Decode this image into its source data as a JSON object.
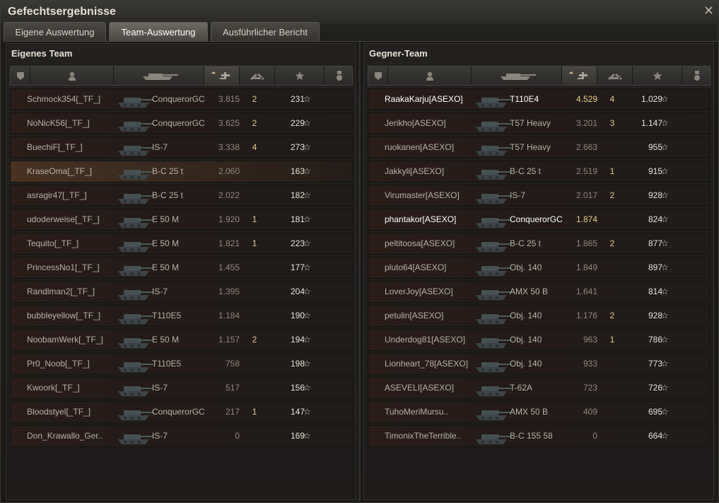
{
  "window": {
    "title": "Gefechtsergebnisse",
    "close_icon": "close-icon"
  },
  "tabs": [
    {
      "label": "Eigene Auswertung"
    },
    {
      "label": "Team-Auswertung"
    },
    {
      "label": "Ausführlicher Bericht"
    }
  ],
  "colors": {
    "accent": "#e6c98a",
    "highlight_row": "#4a3120"
  },
  "own_team": {
    "title": "Eigenes Team",
    "rows": [
      {
        "name": "Schmock354[_TF_]",
        "tank": "ConquerorGC",
        "rating": "3.815",
        "kills": "2",
        "xp": "231"
      },
      {
        "name": "NoNicK56[_TF_]",
        "tank": "ConquerorGC",
        "rating": "3.625",
        "kills": "2",
        "xp": "229"
      },
      {
        "name": "BuechiF[_TF_]",
        "tank": "IS-7",
        "rating": "3.338",
        "kills": "4",
        "xp": "273"
      },
      {
        "name": "KraseOma[_TF_]",
        "tank": "B-C 25 t",
        "rating": "2.060",
        "kills": "",
        "xp": "163"
      },
      {
        "name": "asragir47[_TF_]",
        "tank": "B-C 25 t",
        "rating": "2.022",
        "kills": "",
        "xp": "182"
      },
      {
        "name": "udoderweise[_TF_]",
        "tank": "E 50 M",
        "rating": "1.920",
        "kills": "1",
        "xp": "181"
      },
      {
        "name": "Tequito[_TF_]",
        "tank": "E 50 M",
        "rating": "1.821",
        "kills": "1",
        "xp": "223"
      },
      {
        "name": "PrincessNo1[_TF_]",
        "tank": "E 50 M",
        "rating": "1.455",
        "kills": "",
        "xp": "177"
      },
      {
        "name": "Randlman2[_TF_]",
        "tank": "IS-7",
        "rating": "1.395",
        "kills": "",
        "xp": "204"
      },
      {
        "name": "bubbleyellow[_TF_]",
        "tank": "T110E5",
        "rating": "1.184",
        "kills": "",
        "xp": "190"
      },
      {
        "name": "NoobamWerk[_TF_]",
        "tank": "E 50 M",
        "rating": "1.157",
        "kills": "2",
        "xp": "194"
      },
      {
        "name": "Pr0_Noob[_TF_]",
        "tank": "T110E5",
        "rating": "758",
        "kills": "",
        "xp": "198"
      },
      {
        "name": "Kwoork[_TF_]",
        "tank": "IS-7",
        "rating": "517",
        "kills": "",
        "xp": "156"
      },
      {
        "name": "Bloodstyel[_TF_]",
        "tank": "ConquerorGC",
        "rating": "217",
        "kills": "1",
        "xp": "147"
      },
      {
        "name": "Don_Krawallo_Ger..",
        "tank": "IS-7",
        "rating": "0",
        "kills": "",
        "xp": "169"
      }
    ]
  },
  "enemy_team": {
    "title": "Gegner-Team",
    "rows": [
      {
        "name": "RaakaKarju[ASEXO]",
        "tank": "T110E4",
        "rating": "4.529",
        "kills": "4",
        "xp": "1.029"
      },
      {
        "name": "Jerikho[ASEXO]",
        "tank": "T57 Heavy",
        "rating": "3.201",
        "kills": "3",
        "xp": "1.147"
      },
      {
        "name": "ruokanen[ASEXO]",
        "tank": "T57 Heavy",
        "rating": "2.663",
        "kills": "",
        "xp": "955"
      },
      {
        "name": "Jakkyli[ASEXO]",
        "tank": "B-C 25 t",
        "rating": "2.519",
        "kills": "1",
        "xp": "915"
      },
      {
        "name": "Virumaster[ASEXO]",
        "tank": "IS-7",
        "rating": "2.017",
        "kills": "2",
        "xp": "928"
      },
      {
        "name": "phantakor[ASEXO]",
        "tank": "ConquerorGC",
        "rating": "1.874",
        "kills": "",
        "xp": "824"
      },
      {
        "name": "peltitoosa[ASEXO]",
        "tank": "B-C 25 t",
        "rating": "1.865",
        "kills": "2",
        "xp": "877"
      },
      {
        "name": "pluto64[ASEXO]",
        "tank": "Obj. 140",
        "rating": "1.849",
        "kills": "",
        "xp": "897"
      },
      {
        "name": "LoverJoy[ASEXO]",
        "tank": "AMX 50 B",
        "rating": "1.641",
        "kills": "",
        "xp": "814"
      },
      {
        "name": "petulin[ASEXO]",
        "tank": "Obj. 140",
        "rating": "1.176",
        "kills": "2",
        "xp": "928"
      },
      {
        "name": "Underdog81[ASEXO]",
        "tank": "Obj. 140",
        "rating": "963",
        "kills": "1",
        "xp": "786"
      },
      {
        "name": "Lionheart_78[ASEXO]",
        "tank": "Obj. 140",
        "rating": "933",
        "kills": "",
        "xp": "773"
      },
      {
        "name": "ASEVELI[ASEXO]",
        "tank": "T-62A",
        "rating": "723",
        "kills": "",
        "xp": "726"
      },
      {
        "name": "TuhoMeriMursu..",
        "tank": "AMX 50 B",
        "rating": "409",
        "kills": "",
        "xp": "695"
      },
      {
        "name": "TimonixTheTerrible..",
        "tank": "B-C 155 58",
        "rating": "0",
        "kills": "",
        "xp": "664"
      }
    ]
  }
}
